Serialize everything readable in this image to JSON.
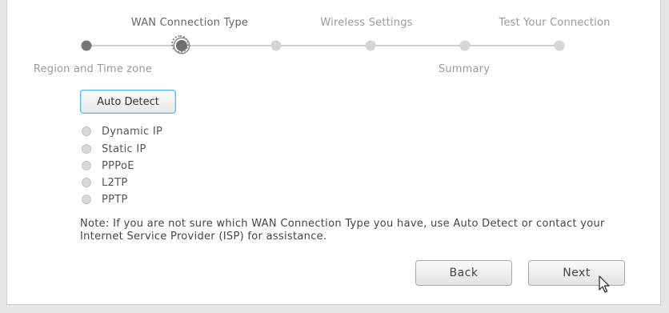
{
  "steps": {
    "upper_labels": [
      "WAN Connection Type",
      "Wireless Settings",
      "Test Your Connection"
    ],
    "lower_labels": [
      "Region and Time zone",
      "Summary"
    ]
  },
  "auto_detect_label": "Auto Detect",
  "connection_types": [
    "Dynamic IP",
    "Static IP",
    "PPPoE",
    "L2TP",
    "PPTP"
  ],
  "note": {
    "prefix": "Note:",
    "text": " If you are not sure which WAN Connection Type you have, use Auto Detect or contact your Internet Service Provider (ISP) for assistance."
  },
  "buttons": {
    "back": "Back",
    "next": "Next"
  },
  "colors": {
    "accent_border": "#59b6e6",
    "step_done": "#777777",
    "step_pending": "#d6d6d6"
  }
}
